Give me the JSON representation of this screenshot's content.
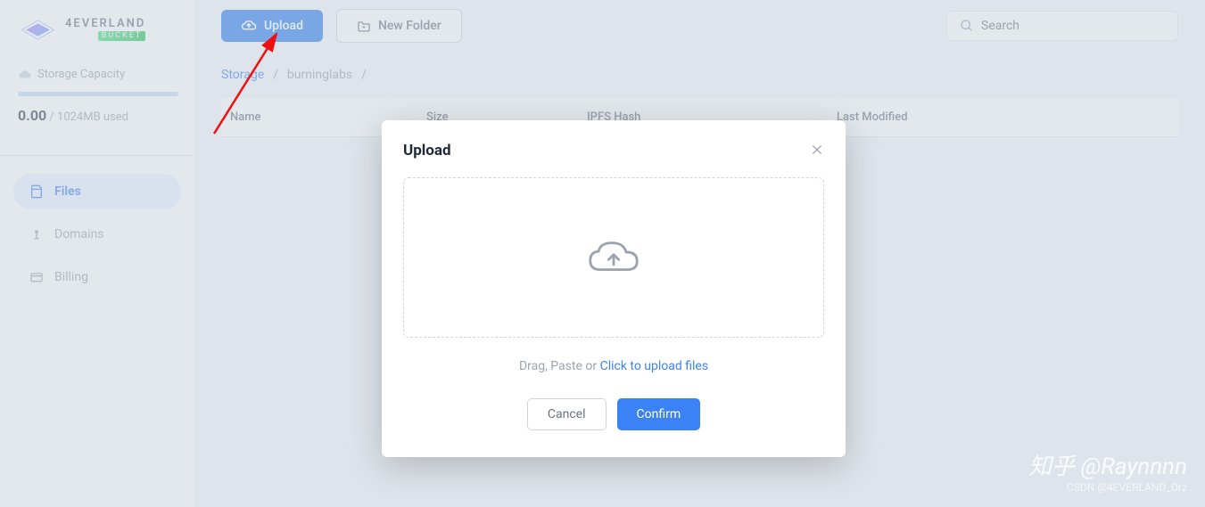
{
  "logo": {
    "brand": "4EVERLAND",
    "sub": "BUCKET"
  },
  "capacity": {
    "label": "Storage Capacity",
    "used": "0.00",
    "total": "1024MB used"
  },
  "nav": {
    "files": "Files",
    "domains": "Domains",
    "billing": "Billing"
  },
  "toolbar": {
    "upload": "Upload",
    "new_folder": "New Folder",
    "search_placeholder": "Search"
  },
  "breadcrumb": {
    "root": "Storage",
    "current": "burninglabs",
    "sep": "/"
  },
  "table": {
    "name": "Name",
    "size": "Size",
    "hash": "IPFS Hash",
    "modified": "Last Modified"
  },
  "modal": {
    "title": "Upload",
    "hint_prefix": "Drag, Paste or ",
    "hint_link": "Click to upload files",
    "cancel": "Cancel",
    "confirm": "Confirm"
  },
  "watermark": {
    "main": "知乎 @Raynnnn",
    "sub": "CSDN @4EVERLAND_Orz"
  }
}
